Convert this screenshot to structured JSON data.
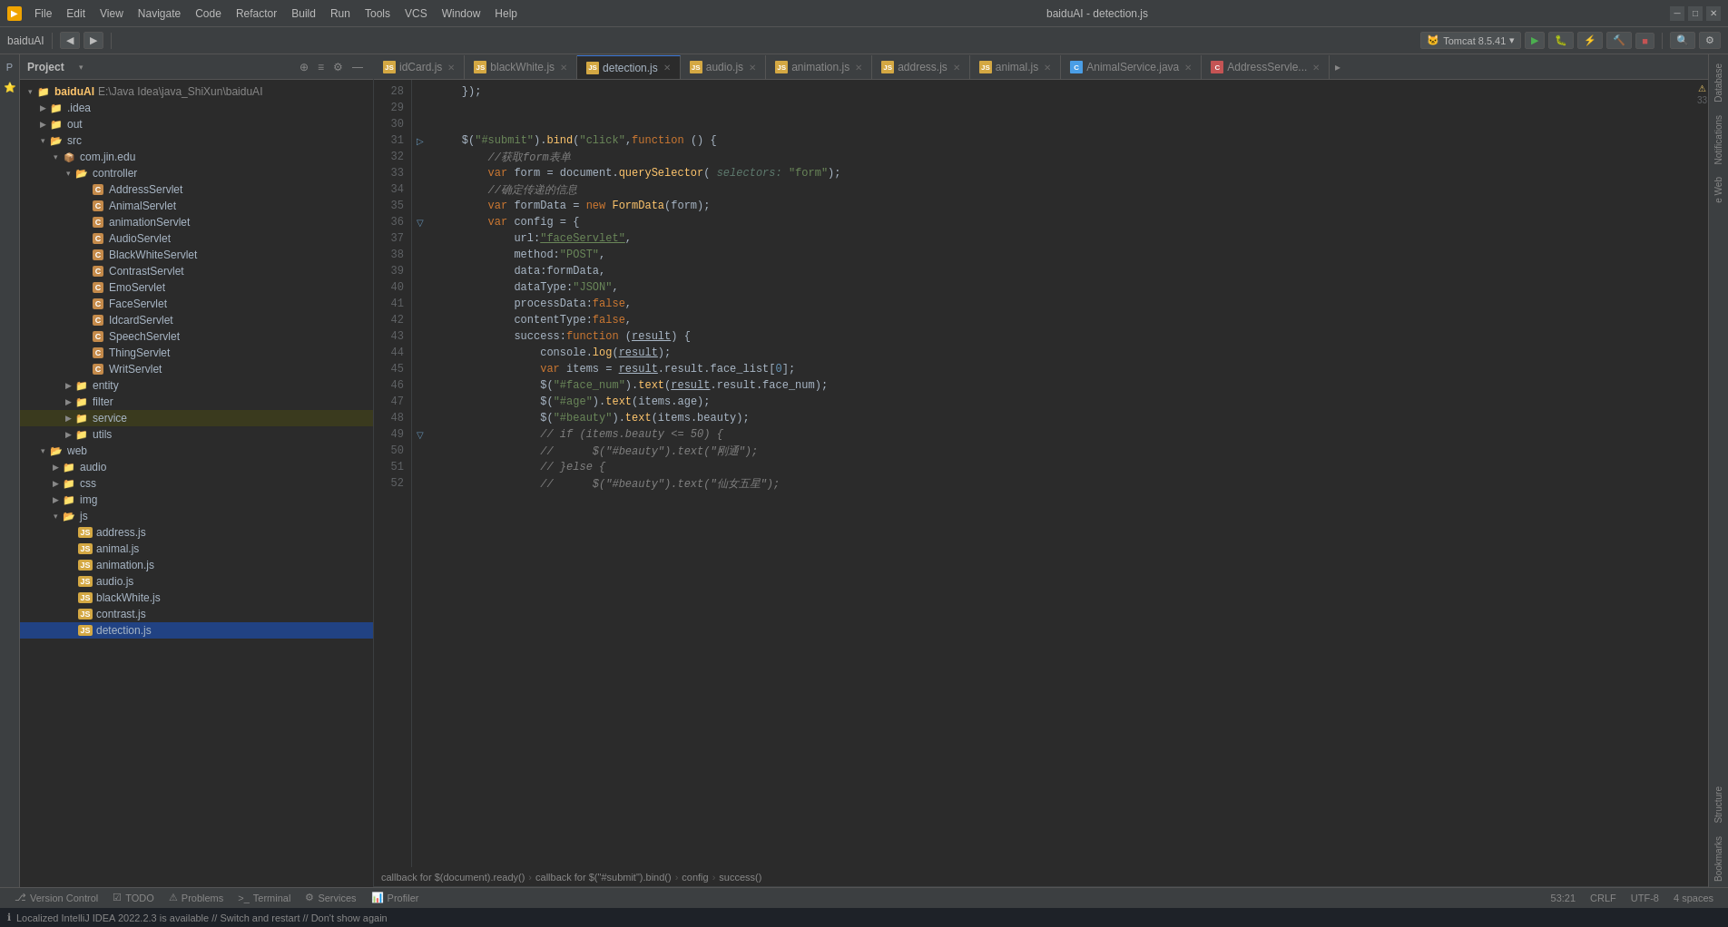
{
  "titleBar": {
    "appName": "baiduAI",
    "fileName": "baiduAI - detection.js",
    "menus": [
      "File",
      "Edit",
      "View",
      "Navigate",
      "Code",
      "Refactor",
      "Build",
      "Run",
      "Tools",
      "VCS",
      "Window",
      "Help"
    ]
  },
  "toolbar": {
    "projectLabel": "baiduAI",
    "tomcatLabel": "Tomcat 8.5.41"
  },
  "fileTree": {
    "title": "Project",
    "rootLabel": "baiduAI",
    "rootPath": "E:\\Java Idea\\java_ShiXun\\baiduAI",
    "items": [
      {
        "id": "idea",
        "label": ".idea",
        "indent": 1,
        "type": "folder",
        "expanded": false
      },
      {
        "id": "out",
        "label": "out",
        "indent": 1,
        "type": "folder",
        "expanded": false
      },
      {
        "id": "src",
        "label": "src",
        "indent": 1,
        "type": "folder",
        "expanded": true
      },
      {
        "id": "com.jin.edu",
        "label": "com.jin.edu",
        "indent": 2,
        "type": "package",
        "expanded": true
      },
      {
        "id": "controller",
        "label": "controller",
        "indent": 3,
        "type": "folder",
        "expanded": true
      },
      {
        "id": "AddressServlet",
        "label": "AddressServlet",
        "indent": 4,
        "type": "java",
        "expanded": false
      },
      {
        "id": "AnimalServlet",
        "label": "AnimalServlet",
        "indent": 4,
        "type": "java"
      },
      {
        "id": "animationServlet",
        "label": "animationServlet",
        "indent": 4,
        "type": "java"
      },
      {
        "id": "AudioServlet",
        "label": "AudioServlet",
        "indent": 4,
        "type": "java"
      },
      {
        "id": "BlackWhiteServlet",
        "label": "BlackWhiteServlet",
        "indent": 4,
        "type": "java"
      },
      {
        "id": "ContrastServlet",
        "label": "ContrastServlet",
        "indent": 4,
        "type": "java"
      },
      {
        "id": "EmoServlet",
        "label": "EmoServlet",
        "indent": 4,
        "type": "java"
      },
      {
        "id": "FaceServlet",
        "label": "FaceServlet",
        "indent": 4,
        "type": "java"
      },
      {
        "id": "IdcardServlet",
        "label": "IdcardServlet",
        "indent": 4,
        "type": "java"
      },
      {
        "id": "SpeechServlet",
        "label": "SpeechServlet",
        "indent": 4,
        "type": "java"
      },
      {
        "id": "ThingServlet",
        "label": "ThingServlet",
        "indent": 4,
        "type": "java"
      },
      {
        "id": "WritServlet",
        "label": "WritServlet",
        "indent": 4,
        "type": "java"
      },
      {
        "id": "entity",
        "label": "entity",
        "indent": 3,
        "type": "folder",
        "expanded": false
      },
      {
        "id": "filter",
        "label": "filter",
        "indent": 3,
        "type": "folder",
        "expanded": false
      },
      {
        "id": "service",
        "label": "service",
        "indent": 3,
        "type": "folder",
        "expanded": false
      },
      {
        "id": "utils",
        "label": "utils",
        "indent": 3,
        "type": "folder",
        "expanded": false
      },
      {
        "id": "web",
        "label": "web",
        "indent": 1,
        "type": "folder",
        "expanded": true
      },
      {
        "id": "audio",
        "label": "audio",
        "indent": 2,
        "type": "folder",
        "expanded": false
      },
      {
        "id": "css",
        "label": "css",
        "indent": 2,
        "type": "folder",
        "expanded": false
      },
      {
        "id": "img",
        "label": "img",
        "indent": 2,
        "type": "folder",
        "expanded": false
      },
      {
        "id": "js",
        "label": "js",
        "indent": 2,
        "type": "folder",
        "expanded": true
      },
      {
        "id": "address.js",
        "label": "address.js",
        "indent": 3,
        "type": "js"
      },
      {
        "id": "animal.js",
        "label": "animal.js",
        "indent": 3,
        "type": "js"
      },
      {
        "id": "animation.js",
        "label": "animation.js",
        "indent": 3,
        "type": "js"
      },
      {
        "id": "audio.js",
        "label": "audio.js",
        "indent": 3,
        "type": "js"
      },
      {
        "id": "blackWhite.js",
        "label": "blackWhite.js",
        "indent": 3,
        "type": "js"
      },
      {
        "id": "contrast.js",
        "label": "contrast.js",
        "indent": 3,
        "type": "js"
      },
      {
        "id": "detection.js",
        "label": "detection.js",
        "indent": 3,
        "type": "js",
        "selected": true
      }
    ]
  },
  "tabs": [
    {
      "label": "idCard.js",
      "type": "js",
      "active": false
    },
    {
      "label": "blackWhite.js",
      "type": "js",
      "active": false
    },
    {
      "label": "detection.js",
      "type": "js",
      "active": true
    },
    {
      "label": "audio.js",
      "type": "js",
      "active": false
    },
    {
      "label": "animation.js",
      "type": "js",
      "active": false
    },
    {
      "label": "address.js",
      "type": "js",
      "active": false
    },
    {
      "label": "animal.js",
      "type": "js",
      "active": false
    },
    {
      "label": "AnimalService.java",
      "type": "java-blue",
      "active": false
    },
    {
      "label": "AddressServle...",
      "type": "java-red",
      "active": false
    }
  ],
  "lineNumbers": [
    "28",
    "29",
    "30",
    "31",
    "32",
    "33",
    "34",
    "35",
    "36",
    "37",
    "38",
    "39",
    "40",
    "41",
    "42",
    "43",
    "44",
    "45",
    "46",
    "47",
    "48",
    "49",
    "50",
    "51",
    "52"
  ],
  "codeLines": [
    "    });",
    "",
    "",
    "    $(\"#submit\").bind(\"click\",function () {",
    "        //获取form表单",
    "        var form = document.querySelector( selectors: \"form\");",
    "        //确定传递的信息",
    "        var formData = new FormData(form);",
    "        var config = {",
    "            url:\"faceServlet\",",
    "            method:\"POST\",",
    "            data:formData,",
    "            dataType:\"JSON\",",
    "            processData:false,",
    "            contentType:false,",
    "            success:function (result) {",
    "                console.log(result);",
    "                var items = result.result.face_list[0];",
    "                $(\"#face_num\").text(result.result.face_num);",
    "                $(\"#age\").text(items.age);",
    "                $(\"#beauty\").text(items.beauty);",
    "                // if (items.beauty <= 50) {",
    "                //      $(\"#beauty\").text(\"刚通\");",
    "                // }else {",
    "                //      $(\"#beauty\").text(\"仙女五星\");"
  ],
  "breadcrumb": {
    "items": [
      "callback for $(document).ready()",
      "callback for $(\"#submit\").bind()",
      "config",
      "success()"
    ]
  },
  "statusBar": {
    "versionControl": "Version Control",
    "todo": "TODO",
    "problems": "Problems",
    "terminal": "Terminal",
    "services": "Services",
    "profiler": "Profiler",
    "position": "53:21",
    "lineEnding": "CRLF",
    "encoding": "UTF-8",
    "indent": "4 spaces",
    "notification": "Localized IntelliJ IDEA 2022.2.3 is available // Switch and restart // Don't show again",
    "lineCount": "33"
  },
  "rightPanel": {
    "labels": [
      "Database",
      "Notifications",
      "e Web",
      "Structure",
      "Bookmarks"
    ]
  }
}
